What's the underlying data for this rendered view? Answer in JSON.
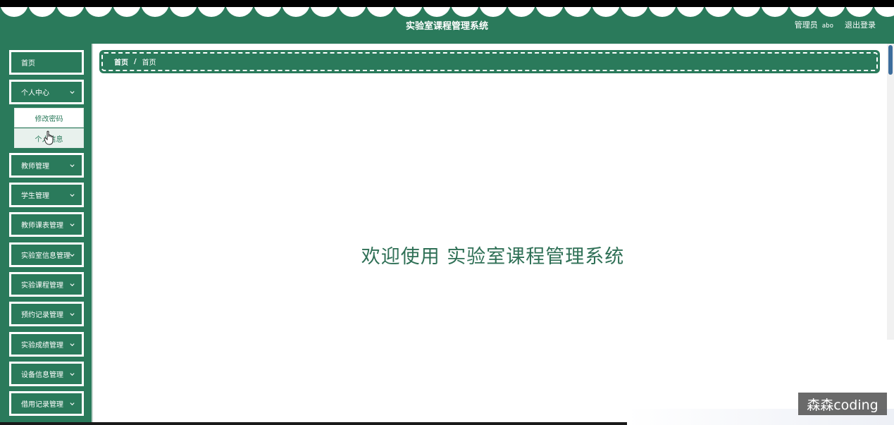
{
  "header": {
    "title": "实验室课程管理系统",
    "role": "管理员",
    "username": "abo",
    "logout": "退出登录"
  },
  "sidebar": {
    "items": [
      {
        "label": "首页"
      },
      {
        "label": "个人中心"
      },
      {
        "label": "教师管理"
      },
      {
        "label": "学生管理"
      },
      {
        "label": "教师课表管理"
      },
      {
        "label": "实验室信息管理"
      },
      {
        "label": "实验课程管理"
      },
      {
        "label": "预约记录管理"
      },
      {
        "label": "实验成绩管理"
      },
      {
        "label": "设备信息管理"
      },
      {
        "label": "借用记录管理"
      }
    ],
    "submenu": [
      {
        "label": "修改密码"
      },
      {
        "label": "个人信息"
      }
    ]
  },
  "breadcrumb": {
    "home": "首页",
    "separator": "/",
    "current": "首页"
  },
  "main": {
    "welcome": "欢迎使用 实验室课程管理系统"
  },
  "watermark": "森森coding",
  "colors": {
    "primary": "#2a7a5b",
    "text_accent": "#2f7056",
    "background": "#ffffff"
  }
}
